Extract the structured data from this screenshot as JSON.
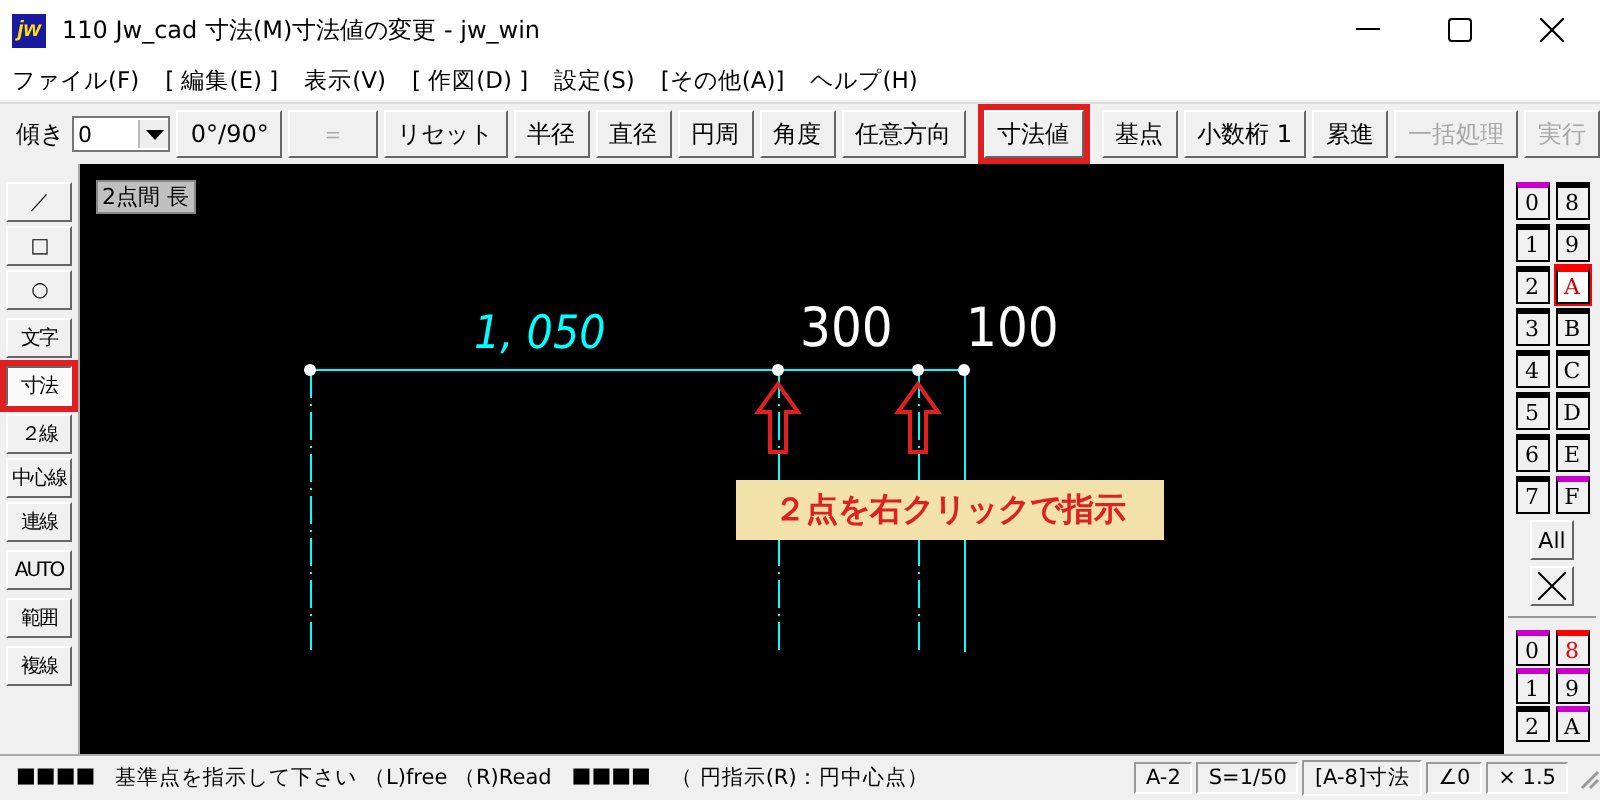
{
  "window": {
    "logo": "jw",
    "title": "110 Jw_cad 寸法(M)寸法値の変更 - jw_win"
  },
  "menu": [
    "ファイル(F)",
    "[ 編集(E) ]",
    "表示(V)",
    "[ 作図(D) ]",
    "設定(S)",
    "[その他(A)]",
    "ヘルプ(H)"
  ],
  "toolbar": {
    "label": "傾き",
    "dropdown": {
      "value": "0"
    },
    "buttons": [
      {
        "label": "0°/90°",
        "disabled": false,
        "highlighted": false
      },
      {
        "label": "＝",
        "disabled": true,
        "highlighted": false
      },
      {
        "label": "リセット",
        "disabled": false,
        "highlighted": false
      },
      {
        "label": "半径",
        "disabled": false,
        "highlighted": false
      },
      {
        "label": "直径",
        "disabled": false,
        "highlighted": false
      },
      {
        "label": "円周",
        "disabled": false,
        "highlighted": false
      },
      {
        "label": "角度",
        "disabled": false,
        "highlighted": false
      },
      {
        "label": "任意方向",
        "disabled": false,
        "highlighted": false
      },
      {
        "label": "寸法値",
        "disabled": false,
        "highlighted": true
      },
      {
        "label": "基点",
        "disabled": false,
        "highlighted": false
      },
      {
        "label": "小数桁 1",
        "disabled": false,
        "highlighted": false
      },
      {
        "label": "累進",
        "disabled": false,
        "highlighted": false
      },
      {
        "label": "一括処理",
        "disabled": true,
        "highlighted": false
      },
      {
        "label": "実行",
        "disabled": true,
        "highlighted": false
      }
    ]
  },
  "left_tools": [
    [
      {
        "label": "／",
        "selected": false,
        "highlighted": false
      },
      {
        "label": "□",
        "selected": false,
        "highlighted": false
      },
      {
        "label": "○",
        "selected": false,
        "highlighted": false
      }
    ],
    [
      {
        "label": "文字",
        "selected": false,
        "highlighted": false
      }
    ],
    [
      {
        "label": "寸法",
        "selected": true,
        "highlighted": true
      }
    ],
    [
      {
        "label": "２線",
        "selected": false,
        "highlighted": false
      },
      {
        "label": "中心線",
        "selected": false,
        "highlighted": false
      },
      {
        "label": "連線",
        "selected": false,
        "highlighted": false
      }
    ],
    [
      {
        "label": "AUTO",
        "selected": false,
        "highlighted": false
      }
    ],
    [
      {
        "label": "範囲",
        "selected": false,
        "highlighted": false
      }
    ],
    [
      {
        "label": "複線",
        "selected": false,
        "highlighted": false
      }
    ]
  ],
  "canvas": {
    "mode_label": "2点間 長",
    "dimension_texts": [
      {
        "text": "1, 050",
        "kind": "cyan"
      },
      {
        "text": "300",
        "kind": "white"
      },
      {
        "text": "100",
        "kind": "white"
      }
    ],
    "callout": "２点を右クリックで指示"
  },
  "layers": [
    {
      "label": "0",
      "selected": false,
      "flagged": true
    },
    {
      "label": "8",
      "selected": false,
      "flagged": false
    },
    {
      "label": "1",
      "selected": false,
      "flagged": false
    },
    {
      "label": "9",
      "selected": false,
      "flagged": false
    },
    {
      "label": "2",
      "selected": false,
      "flagged": false
    },
    {
      "label": "A",
      "selected": true,
      "flagged": false
    },
    {
      "label": "3",
      "selected": false,
      "flagged": false
    },
    {
      "label": "B",
      "selected": false,
      "flagged": false
    },
    {
      "label": "4",
      "selected": false,
      "flagged": false
    },
    {
      "label": "C",
      "selected": false,
      "flagged": false
    },
    {
      "label": "5",
      "selected": false,
      "flagged": false
    },
    {
      "label": "D",
      "selected": false,
      "flagged": false
    },
    {
      "label": "6",
      "selected": false,
      "flagged": false
    },
    {
      "label": "E",
      "selected": false,
      "flagged": false
    },
    {
      "label": "7",
      "selected": false,
      "flagged": false
    },
    {
      "label": "F",
      "selected": false,
      "flagged": true
    }
  ],
  "layer_all": "All",
  "layer_groups": [
    {
      "label": "0",
      "selected": false,
      "flagged": true
    },
    {
      "label": "8",
      "selected": true,
      "flagged": false
    },
    {
      "label": "1",
      "selected": false,
      "flagged": true
    },
    {
      "label": "9",
      "selected": false,
      "flagged": true
    },
    {
      "label": "2",
      "selected": false,
      "flagged": false
    },
    {
      "label": "A",
      "selected": false,
      "flagged": true
    }
  ],
  "status_bar": {
    "marks_1": "■■■■",
    "message": "基準点を指示して下さい （L)free （R)Read",
    "marks_2": "■■■■",
    "hint": "（ 円指示(R)：円中心点）",
    "cells": [
      "A-2",
      "S=1/50",
      "[A-8]寸法",
      "∠0",
      "× 1.5"
    ]
  }
}
